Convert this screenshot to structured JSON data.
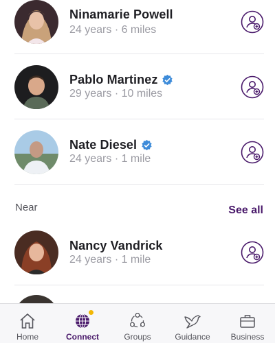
{
  "people": [
    {
      "name": "Ninamarie Powell",
      "meta": "24 years · 6 miles",
      "verified": false,
      "avatar_icon": "avatar-photo"
    },
    {
      "name": "Pablo Martinez",
      "meta": "29 years · 10 miles",
      "verified": true,
      "avatar_icon": "avatar-photo"
    },
    {
      "name": "Nate Diesel",
      "meta": "24 years · 1 mile",
      "verified": true,
      "avatar_icon": "avatar-photo"
    }
  ],
  "near": {
    "section_label": "Near",
    "see_all_label": "See all",
    "people": [
      {
        "name": "Nancy Vandrick",
        "meta": "24 years · 1 mile",
        "verified": false,
        "avatar_icon": "avatar-photo"
      }
    ]
  },
  "tabs": [
    {
      "label": "Home",
      "icon": "home-icon",
      "active": false
    },
    {
      "label": "Connect",
      "icon": "globe-icon",
      "active": true,
      "badge": true
    },
    {
      "label": "Groups",
      "icon": "groups-icon",
      "active": false
    },
    {
      "label": "Guidance",
      "icon": "bird-icon",
      "active": false
    },
    {
      "label": "Business",
      "icon": "briefcase-icon",
      "active": false
    }
  ],
  "colors": {
    "brand_purple": "#4a1a6b",
    "verified_blue": "#3d8bd9",
    "badge_yellow": "#f2b705",
    "meta_gray": "#9a9aa2"
  }
}
